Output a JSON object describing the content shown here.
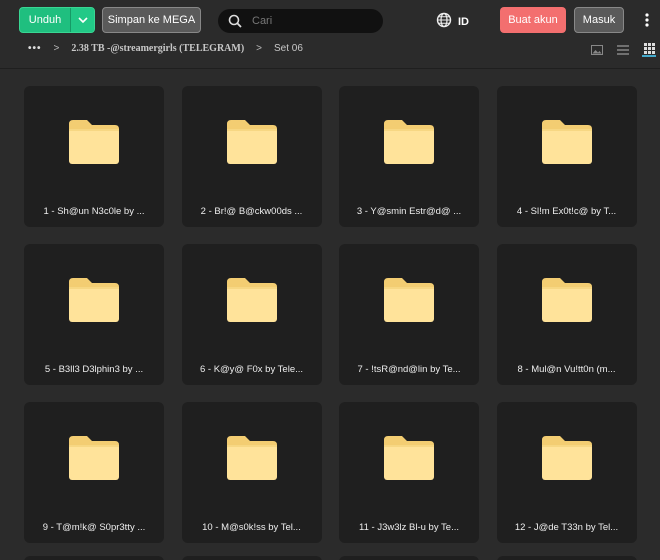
{
  "topbar": {
    "download_label": "Unduh",
    "save_label": "Simpan ke MEGA",
    "search_placeholder": "Cari",
    "language": "ID",
    "signup_label": "Buat akun",
    "login_label": "Masuk"
  },
  "breadcrumb": {
    "more": "•••",
    "folder": "2.38 TB -@streamergirls (TELEGRAM)",
    "current": "Set 06"
  },
  "colors": {
    "accent_green": "#1fbf7f",
    "accent_red": "#f36f6f",
    "folder_yellow": "#ffe39a"
  },
  "items": [
    {
      "label": "1 - Sh@un N3c0le by ...",
      "icon": "folder-icon"
    },
    {
      "label": "2 - Br!@ B@ckw00ds ...",
      "icon": "folder-icon"
    },
    {
      "label": "3 - Y@smin Estr@d@ ...",
      "icon": "folder-icon"
    },
    {
      "label": "4 - Sl!m Ex0t!c@ by T...",
      "icon": "folder-icon"
    },
    {
      "label": "5 - B3ll3 D3lphin3 by ...",
      "icon": "folder-icon"
    },
    {
      "label": "6 - K@y@ F0x by Tele...",
      "icon": "folder-icon"
    },
    {
      "label": "7 - !tsR@nd@lin by Te...",
      "icon": "folder-icon"
    },
    {
      "label": "8 - Mul@n Vu!tt0n (m...",
      "icon": "folder-icon"
    },
    {
      "label": "9 - T@m!k@ S0pr3tty ...",
      "icon": "folder-icon"
    },
    {
      "label": "10 - M@s0k!ss by Tel...",
      "icon": "folder-icon"
    },
    {
      "label": "11 - J3w3lz Bl-u by Te...",
      "icon": "folder-icon"
    },
    {
      "label": "12 - J@de T33n by Tel...",
      "icon": "folder-icon"
    }
  ]
}
